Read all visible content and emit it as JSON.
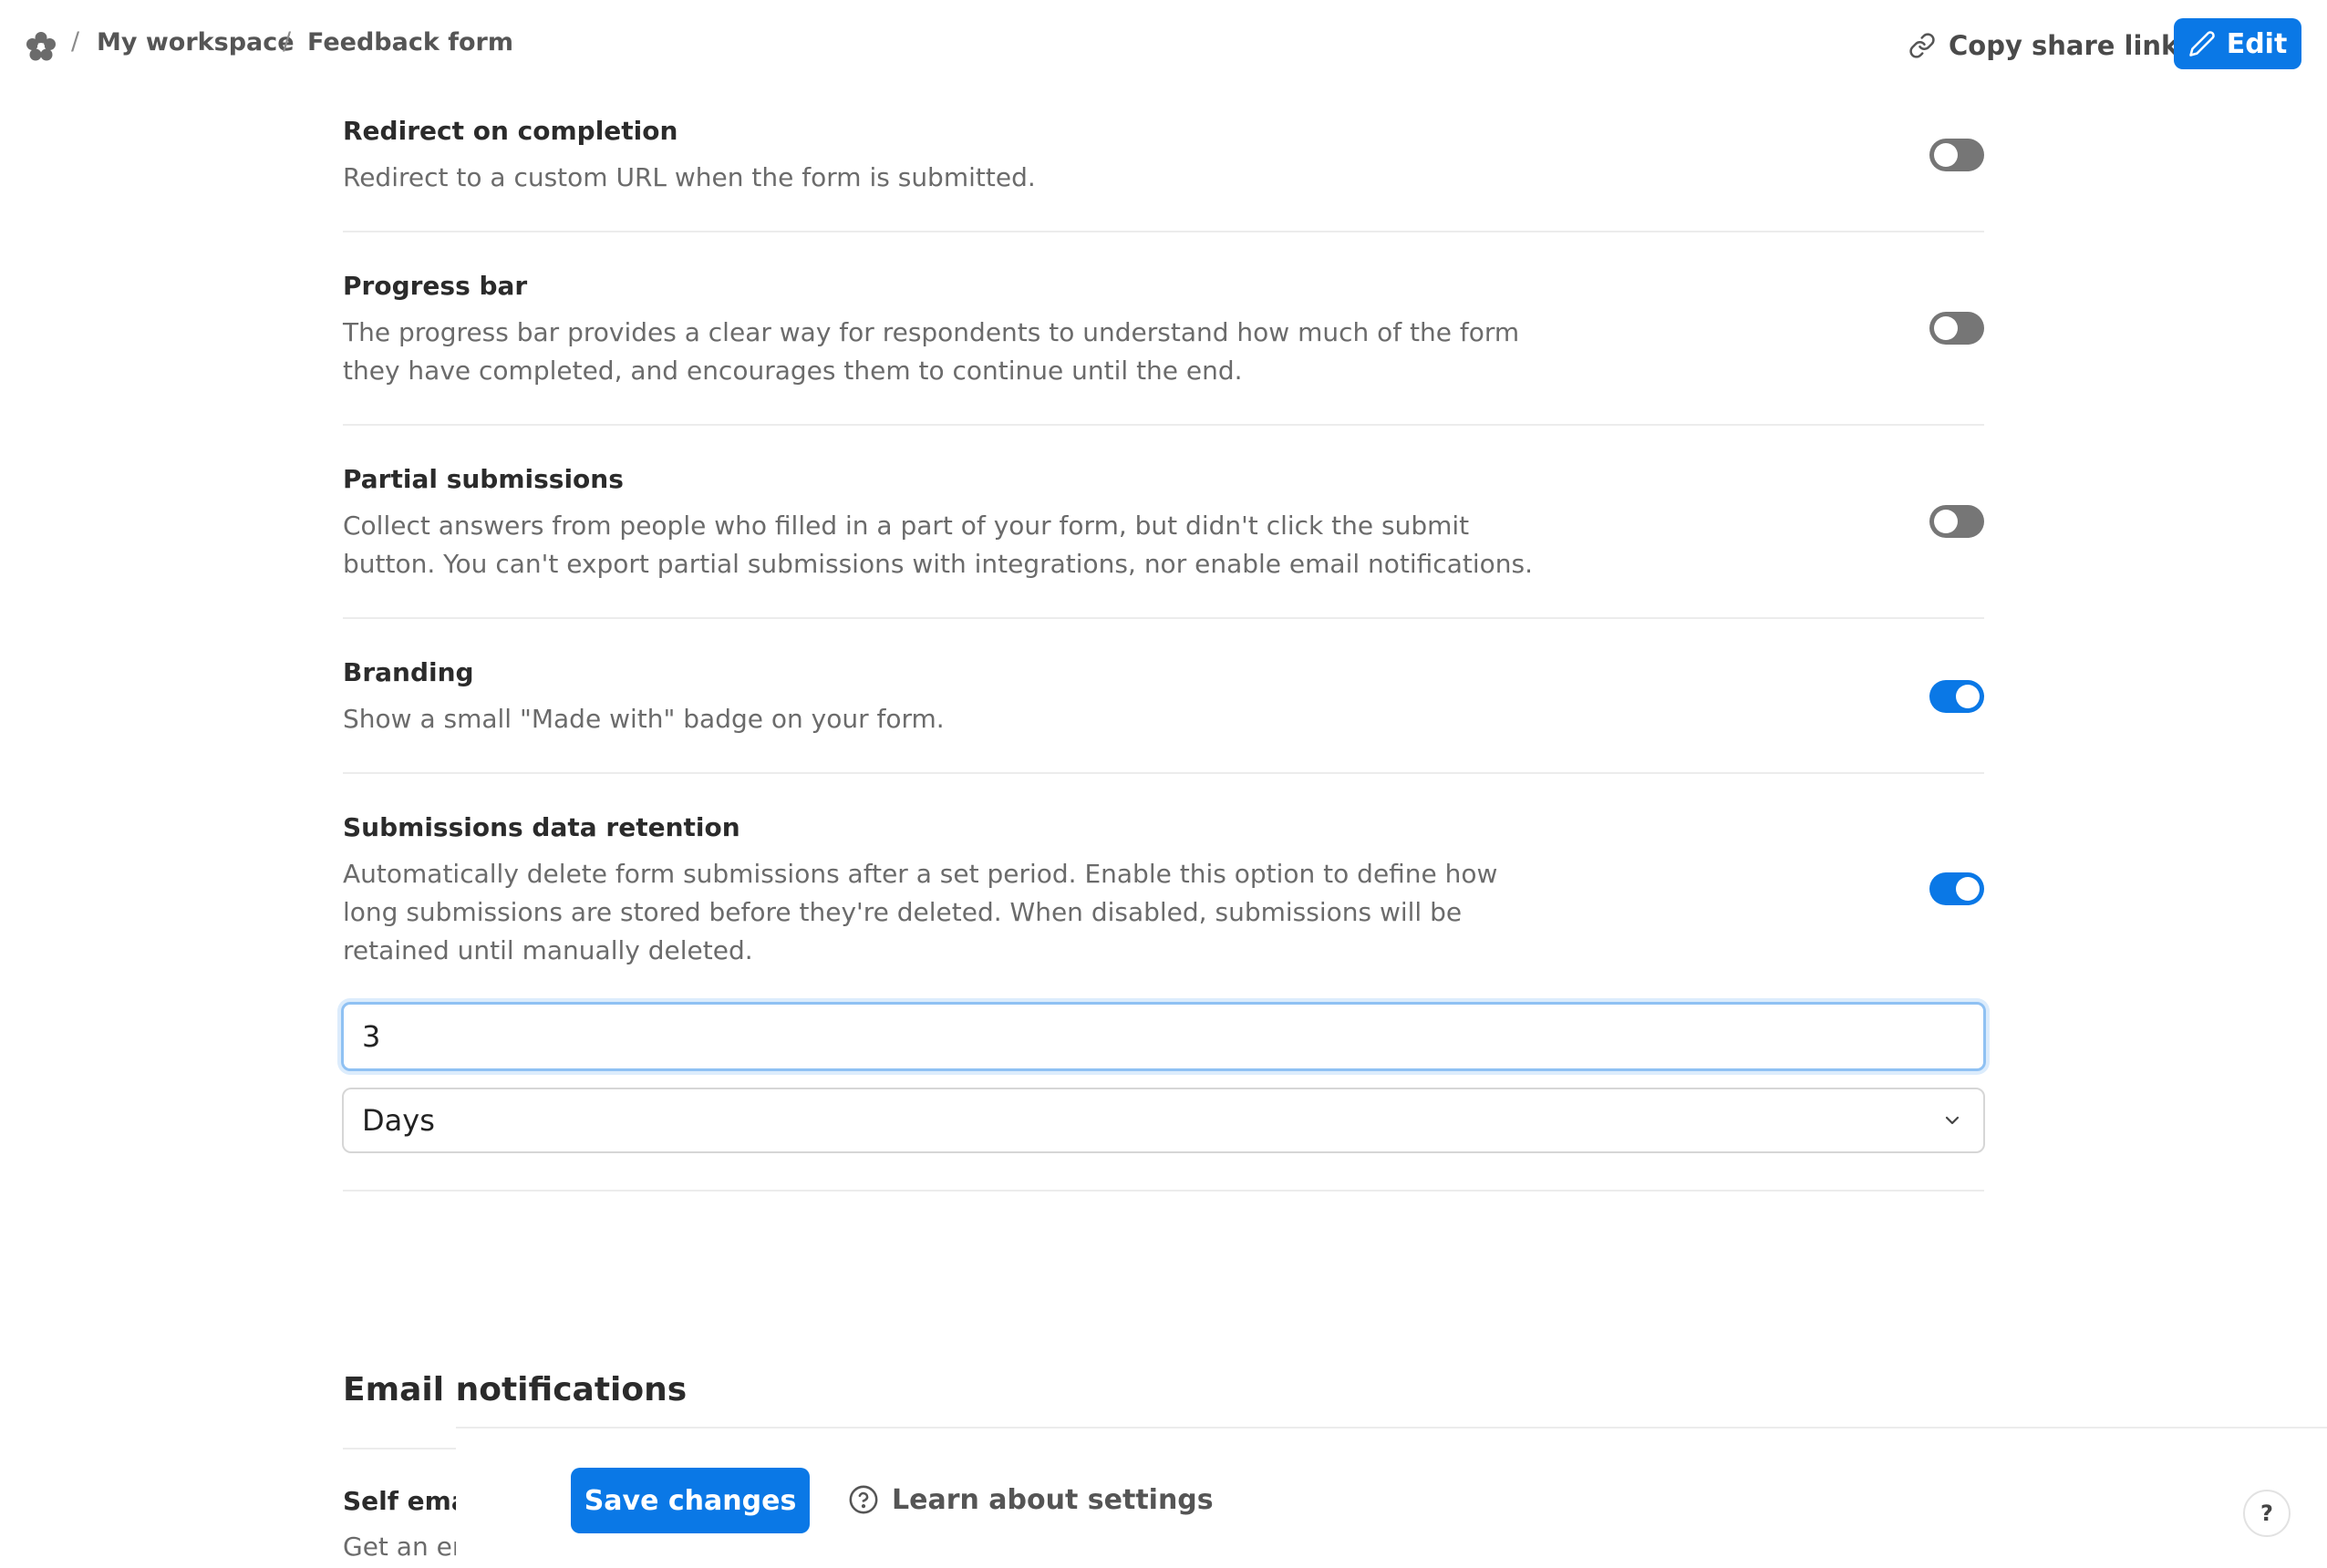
{
  "header": {
    "breadcrumb": [
      "My workspace",
      "Feedback form"
    ],
    "separator": "/",
    "copy_share_link": "Copy share link",
    "edit_label": "Edit"
  },
  "settings": [
    {
      "title": "Redirect on completion",
      "description": "Redirect to a custom URL when the form is submitted.",
      "enabled": false
    },
    {
      "title": "Progress bar",
      "description": "The progress bar provides a clear way for respondents to understand how much of the form they have completed, and encourages them to continue until the end.",
      "enabled": false
    },
    {
      "title": "Partial submissions",
      "description": "Collect answers from people who filled in a part of your form, but didn't click the submit button. You can't export partial submissions with integrations, nor enable email notifications.",
      "enabled": false
    },
    {
      "title": "Branding",
      "description": "Show a small \"Made with\" badge on your form.",
      "enabled": true
    },
    {
      "title": "Submissions data retention",
      "description": "Automatically delete form submissions after a set period. Enable this option to define how long submissions are stored before they're deleted. When disabled, submissions will be retained until manually deleted.",
      "enabled": true
    }
  ],
  "retention": {
    "value": "3",
    "unit": "Days"
  },
  "email_section": {
    "title": "Email notifications",
    "self_email_title": "Self emai",
    "self_email_desc": "Get an en"
  },
  "bottom_bar": {
    "save_label": "Save changes",
    "learn_label": "Learn about settings"
  },
  "help_fab": "?",
  "colors": {
    "accent": "#0a78e6",
    "toggle_off": "#767676"
  }
}
